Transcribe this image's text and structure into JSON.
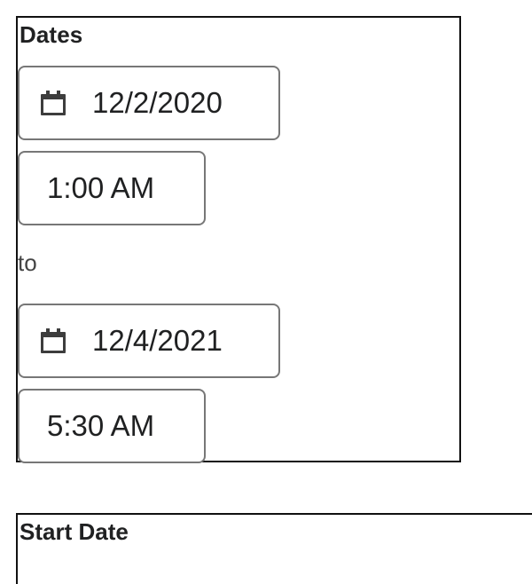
{
  "dates_panel": {
    "title": "Dates",
    "start_date": {
      "value": "12/2/2020",
      "icon": "calendar-icon"
    },
    "start_time": {
      "value": "1:00 AM"
    },
    "connector": "to",
    "end_date": {
      "value": "12/4/2021",
      "icon": "calendar-icon"
    },
    "end_time": {
      "value": "5:30 AM"
    }
  },
  "start_date_panel": {
    "title": "Start Date"
  },
  "colors": {
    "text": "#202122",
    "border": "#777777",
    "panel_border": "#111111"
  }
}
